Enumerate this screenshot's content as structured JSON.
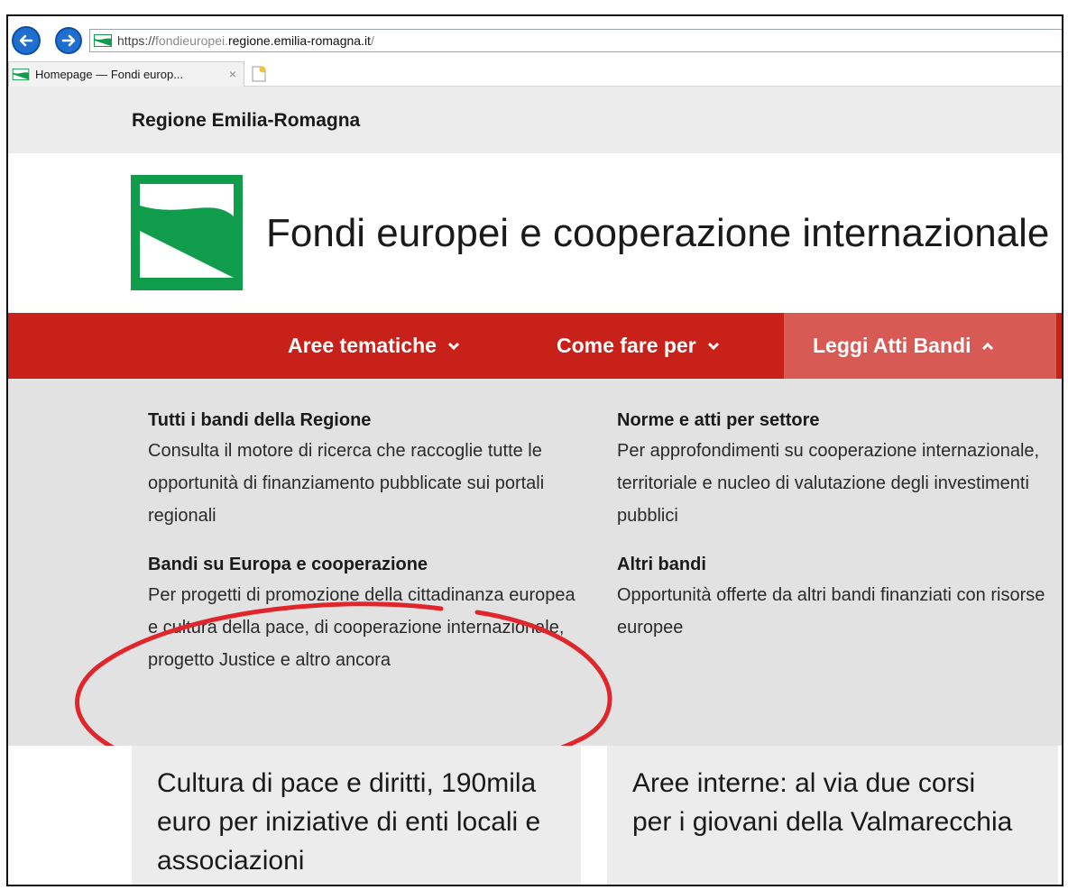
{
  "browser": {
    "url_scheme": "https://",
    "url_subdomain": "fondieuropei.",
    "url_domain": "regione.emilia-romagna.it",
    "url_path": "/",
    "tab_title": "Homepage — Fondi europ...",
    "tab_close": "×"
  },
  "header": {
    "region_name": "Regione Emilia-Romagna",
    "site_title": "Fondi europei e cooperazione internazionale"
  },
  "menu": {
    "items": [
      {
        "label": "Aree tematiche"
      },
      {
        "label": "Come fare per"
      },
      {
        "label": "Leggi Atti Bandi"
      }
    ]
  },
  "dropdown": {
    "blocks": [
      {
        "title": "Tutti i bandi della Regione",
        "description": "Consulta il motore di ricerca che raccoglie tutte le opportunità di finanziamento pubblicate sui portali regionali"
      },
      {
        "title": "Norme e atti per settore",
        "description": "Per approfondimenti su cooperazione internazionale, territoriale e nucleo di valutazione degli investimenti pubblici"
      },
      {
        "title": "Bandi su Europa e cooperazione",
        "description": "Per progetti di promozione della cittadinanza europea e cultura della pace, di cooperazione internazionale, progetto Justice e altro ancora"
      },
      {
        "title": "Altri bandi",
        "description": "Opportunità offerte da altri bandi finanziati con risorse europee"
      }
    ]
  },
  "news": [
    {
      "title": "Cultura di pace e diritti, 190mila euro per iniziative di enti locali e associazioni"
    },
    {
      "title": "Aree interne: al via due corsi per i giovani della Valmarecchia"
    }
  ],
  "colors": {
    "menu_red": "#c8211a",
    "menu_active": "#d85a55",
    "logo_green": "#0f9d4c",
    "annotation_red": "#e0262b"
  }
}
